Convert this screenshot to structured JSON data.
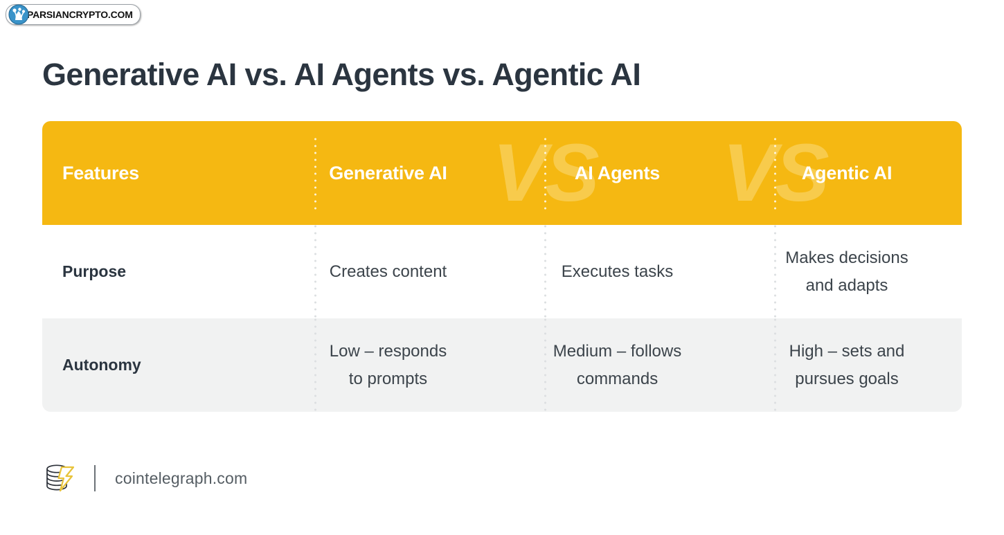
{
  "watermark": {
    "text": "PARSIANCRYPTO.COM",
    "logo_icon": "parsiancrypto-logo-icon",
    "logo_circle_color": "#3a93c9"
  },
  "page_title": "Generative AI vs. AI Agents vs. Agentic AI",
  "table": {
    "header_bg": "#F5B812",
    "alt_row_bg": "#F1F2F2",
    "vs_watermarks": [
      "VS",
      "VS"
    ],
    "columns": [
      "Features",
      "Generative AI",
      "AI Agents",
      "Agentic AI"
    ],
    "rows": [
      {
        "feature": "Purpose",
        "generative_ai": "Creates content",
        "ai_agents": "Executes tasks",
        "agentic_ai_line1": "Makes decisions",
        "agentic_ai_line2": "and adapts"
      },
      {
        "feature": "Autonomy",
        "generative_ai_line1": "Low – responds",
        "generative_ai_line2": "to prompts",
        "ai_agents_line1": "Medium – follows",
        "ai_agents_line2": "commands",
        "agentic_ai_line1": "High – sets and",
        "agentic_ai_line2": "pursues goals"
      }
    ]
  },
  "footer": {
    "logo_icon": "cointelegraph-coins-bolt-icon",
    "url": "cointelegraph.com",
    "bolt_color": "#E8C33A"
  }
}
